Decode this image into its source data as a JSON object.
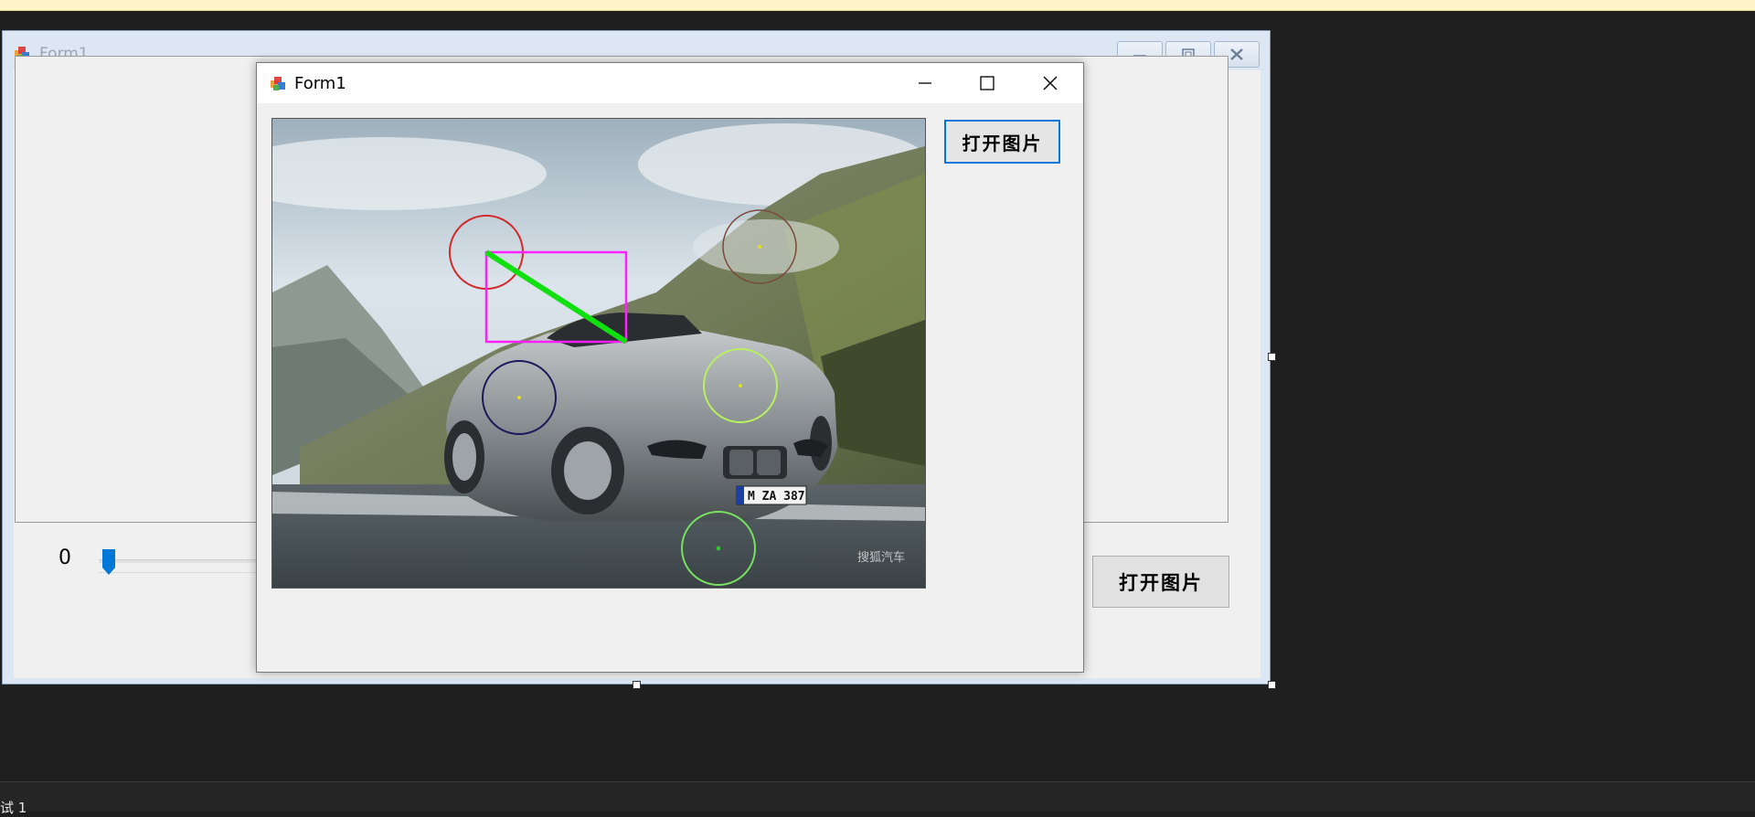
{
  "designer_window": {
    "title": "Form1",
    "trackbar_value": "0",
    "open_button_label": "打开图片"
  },
  "run_window": {
    "title": "Form1",
    "open_button_label": "打开图片",
    "image": {
      "plate_text": "M ZA 387",
      "watermark": "搜狐汽车"
    }
  },
  "status_bar": {
    "text": "试 1"
  },
  "colors": {
    "accent": "#0078d7",
    "circle_red": "#d12a2a",
    "rectangle_magenta": "#ff20ff",
    "line_green": "#10e010"
  }
}
